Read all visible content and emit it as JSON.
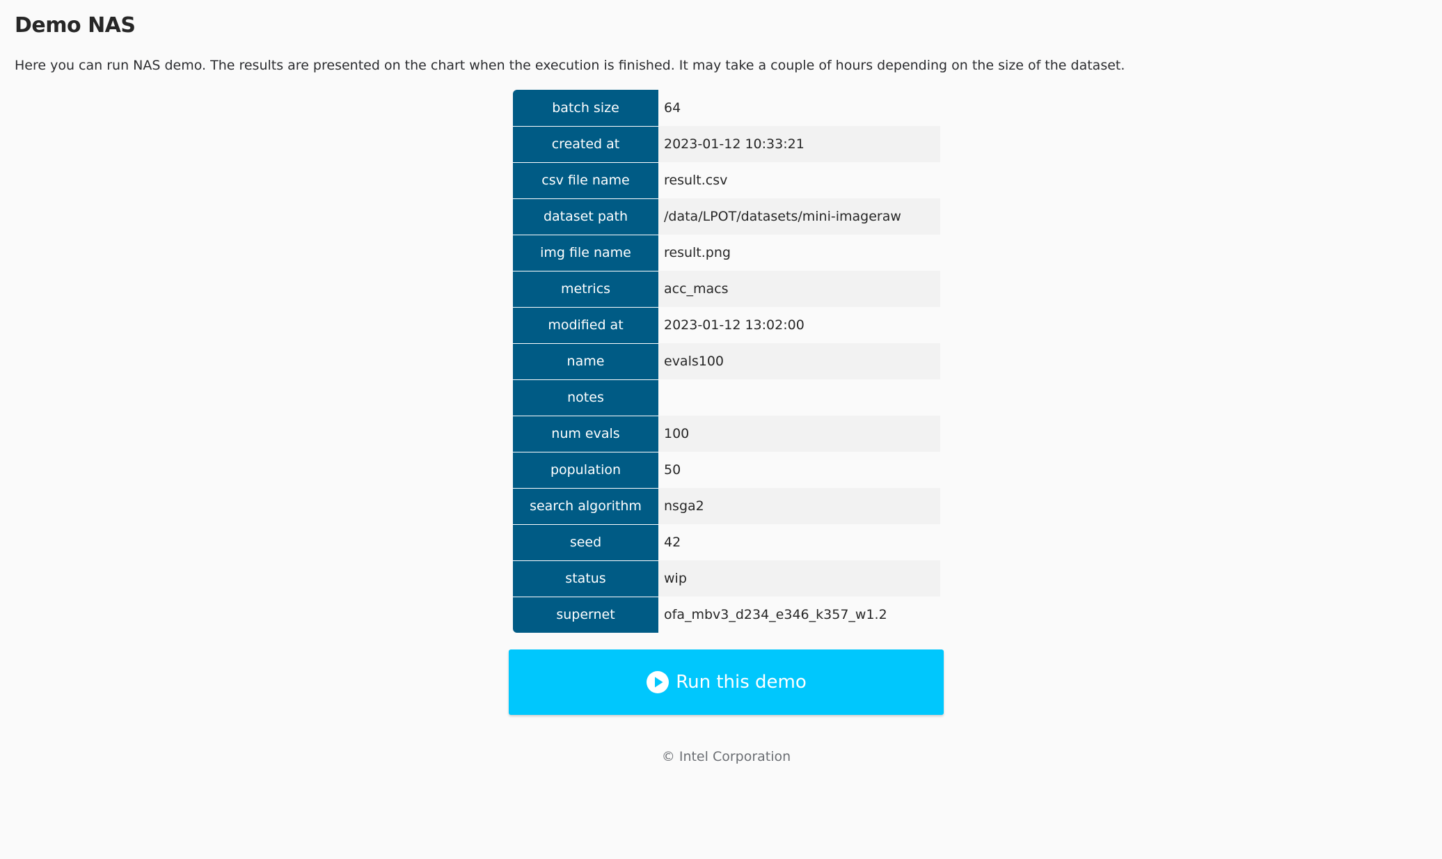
{
  "page": {
    "title": "Demo NAS",
    "description": "Here you can run NAS demo. The results are presented on the chart when the execution is finished. It may take a couple of hours depending on the size of the dataset."
  },
  "details": [
    {
      "key": "batch size",
      "value": "64"
    },
    {
      "key": "created at",
      "value": "2023-01-12 10:33:21"
    },
    {
      "key": "csv file name",
      "value": "result.csv"
    },
    {
      "key": "dataset path",
      "value": "/data/LPOT/datasets/mini-imageraw"
    },
    {
      "key": "img file name",
      "value": "result.png"
    },
    {
      "key": "metrics",
      "value": "acc_macs"
    },
    {
      "key": "modified at",
      "value": "2023-01-12 13:02:00"
    },
    {
      "key": "name",
      "value": "evals100"
    },
    {
      "key": "notes",
      "value": ""
    },
    {
      "key": "num evals",
      "value": "100"
    },
    {
      "key": "population",
      "value": "50"
    },
    {
      "key": "search algorithm",
      "value": "nsga2"
    },
    {
      "key": "seed",
      "value": "42"
    },
    {
      "key": "status",
      "value": "wip"
    },
    {
      "key": "supernet",
      "value": "ofa_mbv3_d234_e346_k357_w1.2"
    }
  ],
  "run_button": {
    "label": "Run this demo",
    "icon": "play-circle-icon"
  },
  "footer": {
    "text": "© Intel Corporation"
  },
  "colors": {
    "table_key_bg": "#005b85",
    "button_bg": "#00c7fd",
    "page_bg": "#fafafa"
  }
}
